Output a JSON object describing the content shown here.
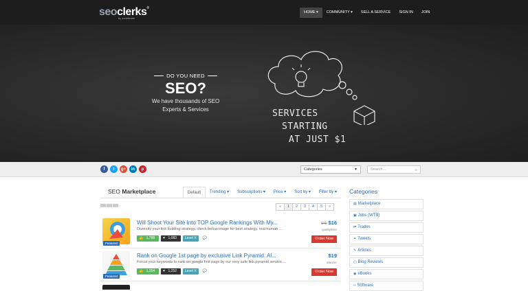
{
  "nav": {
    "logo": {
      "seo": "seo",
      "clerks": "clerks",
      "sub": "by zonefeatre"
    },
    "items": [
      {
        "label": "HOME ▾",
        "active": true
      },
      {
        "label": "COMMUNITY ▾",
        "active": false
      },
      {
        "label": "SELL A SERVICE",
        "active": false
      },
      {
        "label": "SIGN IN",
        "active": false
      },
      {
        "label": "JOIN",
        "active": false
      }
    ]
  },
  "hero": {
    "question": "DO YOU NEED",
    "big": "SEO?",
    "desc_line1": "We have thousands of SEO",
    "desc_line2": "Experts & Services",
    "chalk": [
      "SERVICES",
      "STARTING",
      "AT JUST $1"
    ]
  },
  "band": {
    "social": [
      "f",
      "t",
      "g+",
      "in",
      "p"
    ],
    "categories_select": "Categories",
    "search_placeholder": "Search..."
  },
  "main": {
    "title_prefix": "SEO",
    "title_strong": "Marketplace",
    "tabs": [
      "Default",
      "Trending ▾",
      "Subscriptions ▾",
      "Price ▾",
      "Sort by ▾",
      "Filter by ▾"
    ],
    "pager": [
      "«",
      "1",
      "2",
      "3",
      "4",
      "5",
      "»"
    ],
    "listings": [
      {
        "title": "Will Shoot Your Site Into TOP Google Rankings With My...",
        "old_price": "$45",
        "price": "$16",
        "desc": "Diversify your link building strategy, check below image for best strategy, real human ...",
        "seller": "qualitylinks",
        "likes": "1,788",
        "hearts": "1,083",
        "level": "Level X",
        "comments": "0",
        "featured": "Featured",
        "order": "Order Now"
      },
      {
        "title": "Rank on Google 1st page by exclusive Link Pyramid. Al...",
        "old_price": "",
        "price": "$19",
        "desc": "Forcst your keywords to rank on google first page by our very safe link pyramid service....",
        "seller": "afanzer",
        "likes": "1,354",
        "hearts": "1,252",
        "level": "Level X",
        "comments": "0",
        "featured": "Featured",
        "order": "Order Now"
      }
    ]
  },
  "sidebar": {
    "heading": "Categories",
    "items": [
      "Marketplace",
      "Jobs (WTB)",
      "Trades",
      "Tweets",
      "Articles",
      "Blog Reviews",
      "eBooks",
      "Software"
    ]
  },
  "colors": {
    "accent": "#2a6ebb",
    "order": "#d9382f",
    "topbar": "#1d1d1d"
  }
}
